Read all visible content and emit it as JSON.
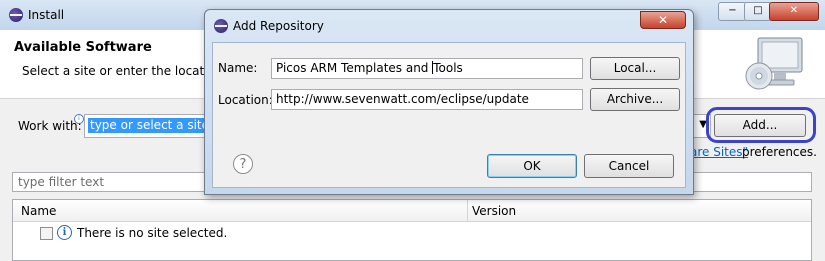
{
  "install_window": {
    "title": "Install",
    "heading": "Available Software",
    "description": "Select a site or enter the location of",
    "work_with_label": "Work with:",
    "work_with_value": "type or select a site",
    "add_button": "Add...",
    "available_sites_link": "are Sites\"",
    "preferences_text": "preferences.",
    "filter_placeholder": "type filter text",
    "columns": {
      "name": "Name",
      "version": "Version"
    },
    "empty_row_text": "There is no site selected.",
    "window_buttons": {
      "minimize": "−",
      "maximize": "□",
      "close": "✕"
    }
  },
  "add_repository_dialog": {
    "title": "Add Repository",
    "name_label": "Name:",
    "name_value_before_caret": "Picos ARM Templates and ",
    "name_value_after_caret": "Tools",
    "location_label": "Location:",
    "location_value": "http://www.sevenwatt.com/eclipse/update",
    "local_button": "Local...",
    "archive_button": "Archive...",
    "ok_button": "OK",
    "cancel_button": "Cancel",
    "close_symbol": "✕",
    "help_symbol": "?"
  },
  "colors": {
    "selection": "#3399ff",
    "highlight_ring": "#3b44c9",
    "link": "#0066cc",
    "close_button": "#c7422c"
  }
}
